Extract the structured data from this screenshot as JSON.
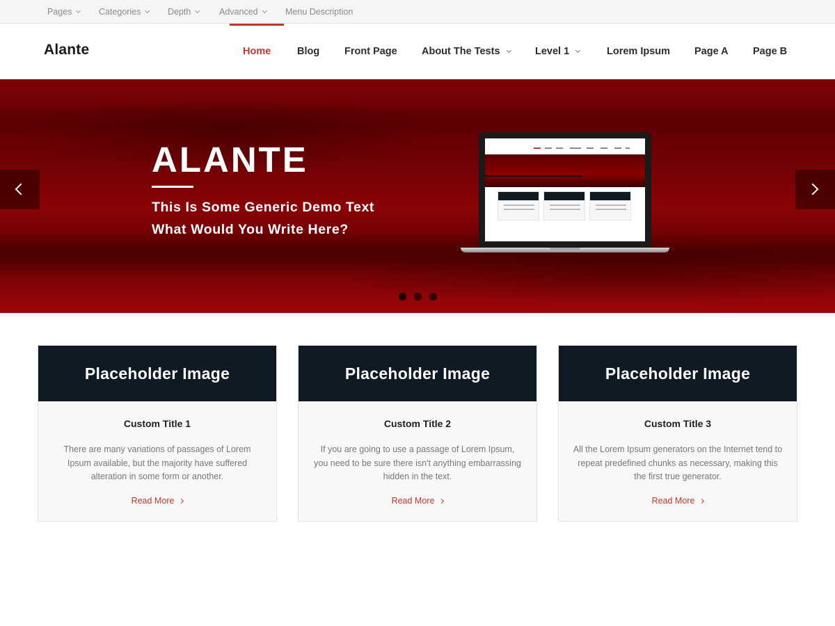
{
  "topbar": {
    "items": [
      {
        "label": "Pages",
        "has_dropdown": true
      },
      {
        "label": "Categories",
        "has_dropdown": true
      },
      {
        "label": "Depth",
        "has_dropdown": true
      },
      {
        "label": "Advanced",
        "has_dropdown": true
      },
      {
        "label": "Menu Description",
        "has_dropdown": false
      }
    ]
  },
  "header": {
    "logo": "Alante",
    "nav": [
      {
        "label": "Home",
        "active": true
      },
      {
        "label": "Blog"
      },
      {
        "label": "Front Page"
      },
      {
        "label": "About The Tests",
        "has_dropdown": true
      },
      {
        "label": "Level 1",
        "has_dropdown": true
      },
      {
        "label": "Lorem Ipsum"
      },
      {
        "label": "Page A"
      },
      {
        "label": "Page B"
      }
    ]
  },
  "hero": {
    "title": "ALANTE",
    "subtitle_line1": "This Is Some Generic Demo Text",
    "subtitle_line2": "What Would You Write Here?",
    "slide_count": 3,
    "active_slide": 1,
    "prev_icon": "chevron-left-icon",
    "next_icon": "chevron-right-icon"
  },
  "cards": [
    {
      "image_label": "Placeholder Image",
      "title": "Custom Title 1",
      "text": "There are many variations of passages of Lorem Ipsum available, but the majority have suffered alteration in some form or another.",
      "link": "Read More"
    },
    {
      "image_label": "Placeholder Image",
      "title": "Custom Title 2",
      "text": "If you are going to use a passage of Lorem Ipsum, you need to be sure there isn't anything embarrassing hidden in the text.",
      "link": "Read More"
    },
    {
      "image_label": "Placeholder Image",
      "title": "Custom Title 3",
      "text": "All the Lorem Ipsum generators on the Internet tend to repeat predefined chunks as necessary, making this the first true generator.",
      "link": "Read More"
    }
  ],
  "colors": {
    "accent": "#c0392b",
    "card_header": "#101a24",
    "hero_red": "#7a0205"
  }
}
